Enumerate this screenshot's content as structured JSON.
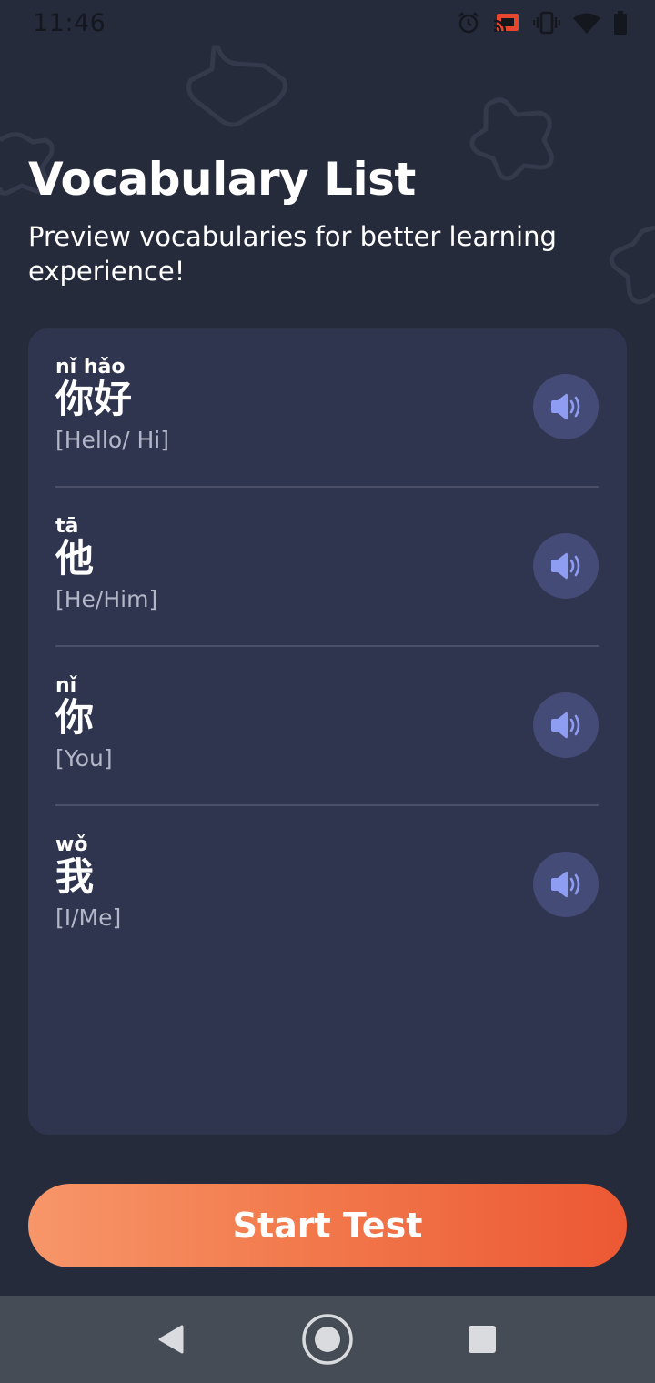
{
  "status_bar": {
    "time": "11:46",
    "icons": [
      "alarm-icon",
      "cast-icon",
      "vibrate-icon",
      "wifi-icon",
      "battery-icon"
    ]
  },
  "header": {
    "title": "Vocabulary List",
    "subtitle": "Preview vocabularies for better learning experience!"
  },
  "vocabulary": [
    {
      "pinyin": "nǐ hǎo",
      "hanzi": "你好",
      "meaning": "[Hello/ Hi]"
    },
    {
      "pinyin": "tā",
      "hanzi": "他",
      "meaning": "[He/Him]"
    },
    {
      "pinyin": "nǐ",
      "hanzi": "你",
      "meaning": "[You]"
    },
    {
      "pinyin": "wǒ",
      "hanzi": "我",
      "meaning": "[I/Me]"
    }
  ],
  "start_button": {
    "label": "Start Test"
  },
  "nav_bar": {
    "buttons": [
      "back-icon",
      "home-icon",
      "recents-icon"
    ]
  },
  "colors": {
    "background": "#262b3b",
    "card": "#30354f",
    "audio_button": "#444b77",
    "speaker_icon": "#8e9cf2",
    "button_gradient_start": "#f7966a",
    "button_gradient_end": "#ec5834"
  }
}
